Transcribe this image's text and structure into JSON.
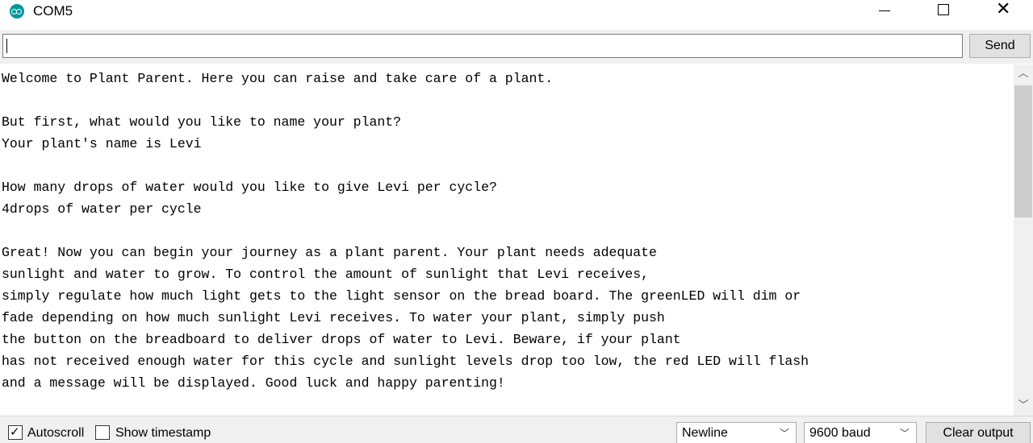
{
  "window": {
    "title": "COM5",
    "accent_color": "#00979c"
  },
  "input": {
    "value": "",
    "send_label": "Send"
  },
  "output": {
    "lines": [
      "Welcome to Plant Parent. Here you can raise and take care of a plant.",
      "",
      "But first, what would you like to name your plant?",
      "Your plant's name is Levi",
      "",
      "How many drops of water would you like to give Levi per cycle?",
      "4drops of water per cycle",
      "",
      "Great! Now you can begin your journey as a plant parent. Your plant needs adequate",
      "sunlight and water to grow. To control the amount of sunlight that Levi receives,",
      "simply regulate how much light gets to the light sensor on the bread board. The greenLED will dim or",
      "fade depending on how much sunlight Levi receives. To water your plant, simply push",
      "the button on the breadboard to deliver drops of water to Levi. Beware, if your plant",
      "has not received enough water for this cycle and sunlight levels drop too low, the red LED will flash",
      "and a message will be displayed. Good luck and happy parenting!"
    ]
  },
  "footer": {
    "autoscroll_label": "Autoscroll",
    "autoscroll_checked": true,
    "timestamp_label": "Show timestamp",
    "timestamp_checked": false,
    "line_ending": "Newline",
    "baud_rate": "9600 baud",
    "clear_label": "Clear output"
  }
}
